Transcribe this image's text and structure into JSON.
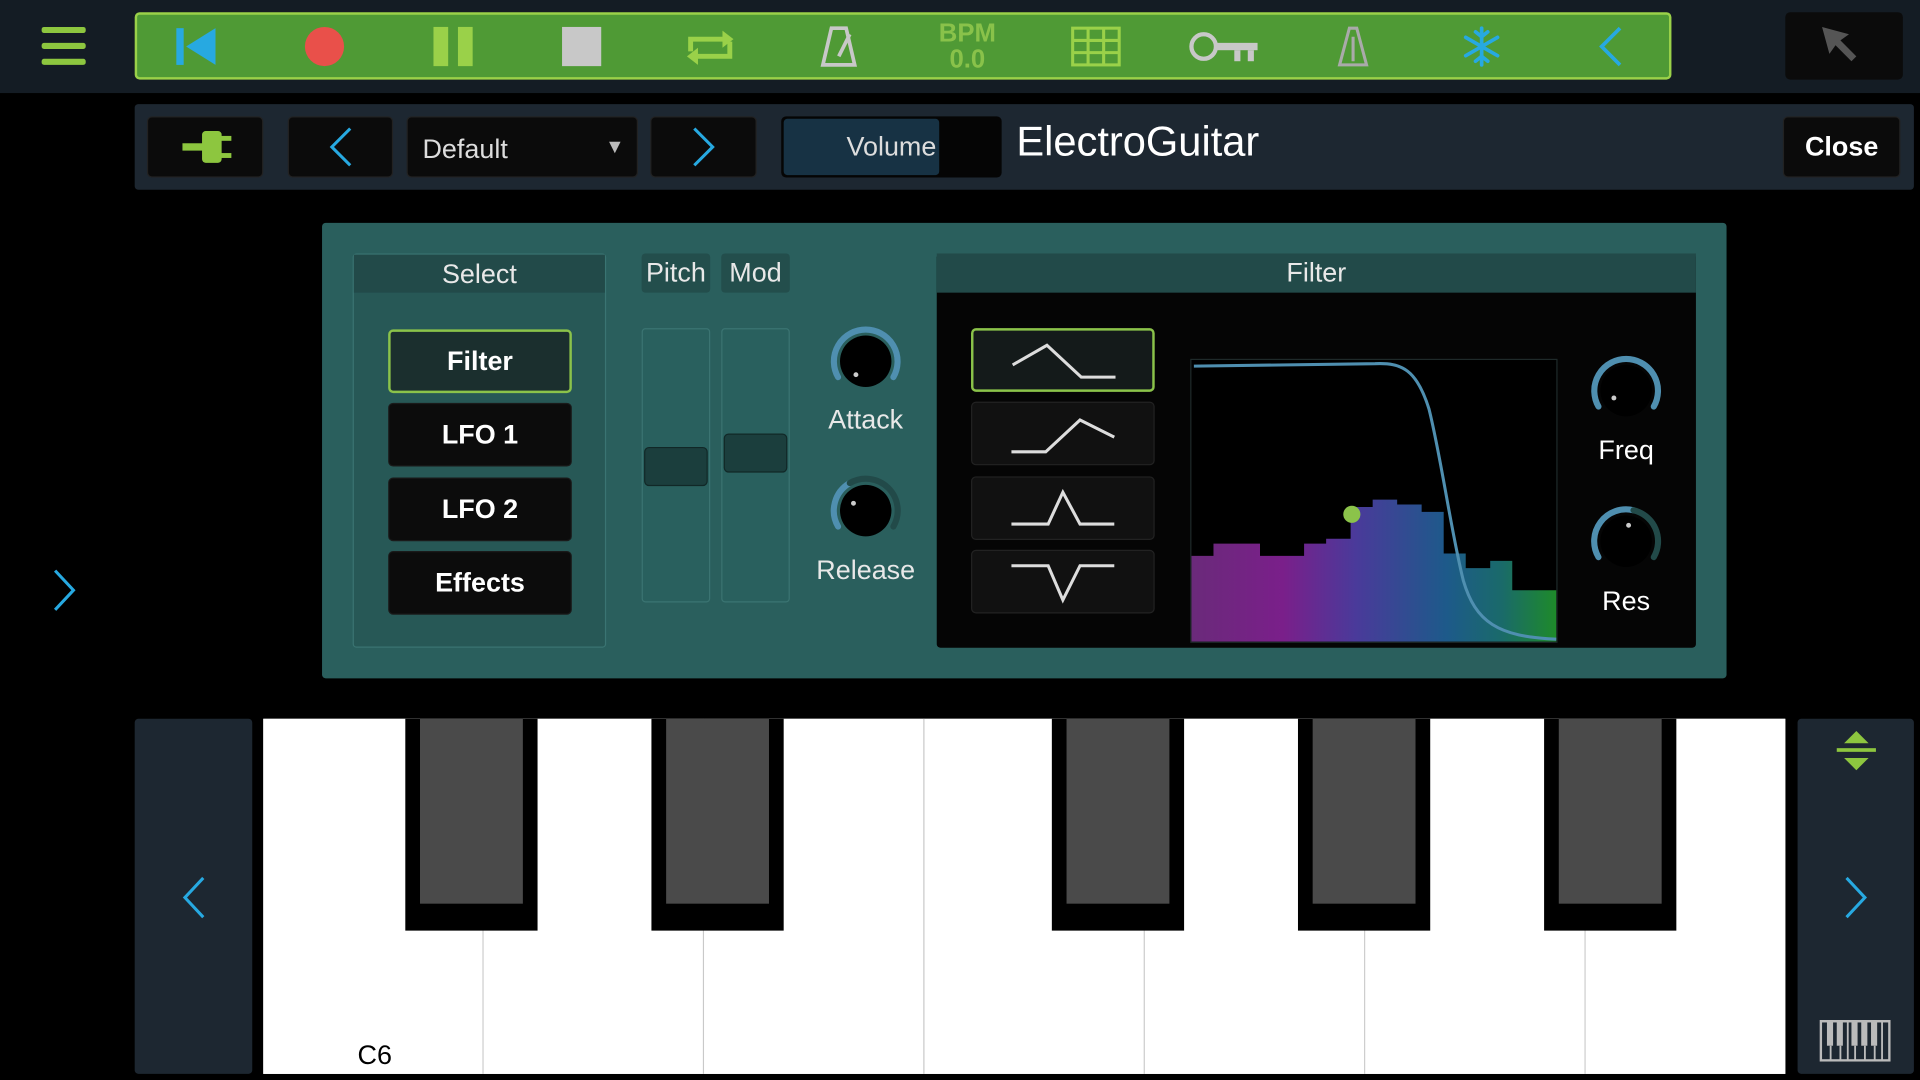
{
  "transport": {
    "bpm_label": "BPM",
    "bpm_value": "0.0",
    "accent": "#8dc63f",
    "bar_color": "#4f9a35"
  },
  "instrument_bar": {
    "preset": "Default",
    "volume_label": "Volume",
    "volume_level_percent": 72,
    "instrument_name": "ElectroGuitar",
    "close_label": "Close"
  },
  "synth": {
    "select": {
      "title": "Select",
      "items": [
        {
          "label": "Filter",
          "active": true
        },
        {
          "label": "LFO 1",
          "active": false
        },
        {
          "label": "LFO 2",
          "active": false
        },
        {
          "label": "Effects",
          "active": false
        }
      ]
    },
    "pitch_label": "Pitch",
    "mod_label": "Mod",
    "attack_label": "Attack",
    "release_label": "Release",
    "filter": {
      "title": "Filter",
      "types": [
        "lowpass-icon",
        "highpass-icon",
        "bandpass-icon",
        "notch-icon"
      ],
      "active_type": 0,
      "freq_label": "Freq",
      "res_label": "Res"
    }
  },
  "keyboard": {
    "note_label": "C6"
  },
  "colors": {
    "panel": "#2a5f5d",
    "active_border": "#8bc34a",
    "knob_ring": "#4f8fb0",
    "icon_blue": "#3aa6e0"
  }
}
